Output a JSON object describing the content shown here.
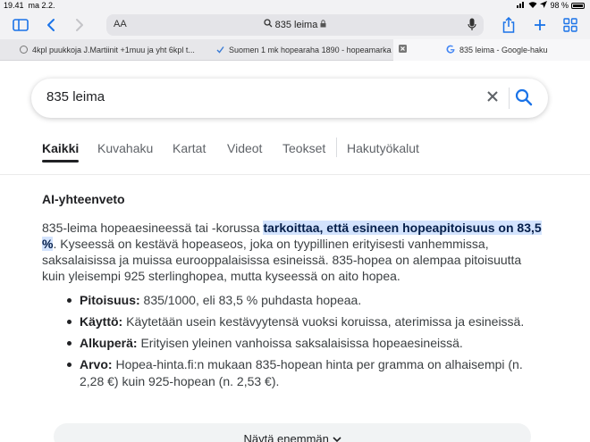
{
  "status": {
    "time": "19.41",
    "date": "ma 2.2.",
    "battery": "98 %"
  },
  "browser": {
    "font_size_label": "AA",
    "address": "835 leima",
    "tabs": [
      {
        "label": "4kpl puukkoja J.Martiinit +1muu ja yht 6kpl t...",
        "icon": "page-icon"
      },
      {
        "label": "Suomen 1 mk hopearaha 1890 - hopeamarka...",
        "icon": "check-icon"
      },
      {
        "label": "835 leima - Google-haku",
        "icon": "google-icon",
        "active": true
      }
    ]
  },
  "search": {
    "query": "835 leima"
  },
  "nav": {
    "items": [
      "Kaikki",
      "Kuvahaku",
      "Kartat",
      "Videot",
      "Teokset",
      "Hakutyökalut"
    ]
  },
  "ai": {
    "title": "AI-yhteenveto",
    "p_start": "835-leima hopeaesineessä tai -korussa ",
    "p_highlight": "tarkoittaa, että esineen hopeapitoisuus on 83,5 %",
    "p_rest": ". Kyseessä on kestävä hopeaseos, joka on tyypillinen erityisesti vanhemmissa, saksalaisissa ja muissa eurooppalaisissa esineissä. 835-hopea on alempaa pitoisuutta kuin yleisempi 925 sterlinghopea, mutta kyseessä on aito hopea.",
    "bullets": [
      {
        "label": "Pitoisuus:",
        "text": " 835/1000, eli 83,5 % puhdasta hopeaa."
      },
      {
        "label": "Käyttö:",
        "text": " Käytetään usein kestävyytensä vuoksi koruissa, aterimissa ja esineissä."
      },
      {
        "label": "Alkuperä:",
        "text": " Erityisen yleinen vanhoissa saksalaisissa hopeaesineissä."
      },
      {
        "label": "Arvo:",
        "text": " Hopea-hinta.fi:n mukaan 835-hopean hinta per gramma on alhaisempi (n. 2,28 €) kuin 925-hopean (n. 2,53 €)."
      }
    ],
    "show_more": "Näytä enemmän"
  },
  "colors": {
    "accent": "#1a73e8",
    "highlight": "#d3e3fd",
    "text": "#202124"
  }
}
